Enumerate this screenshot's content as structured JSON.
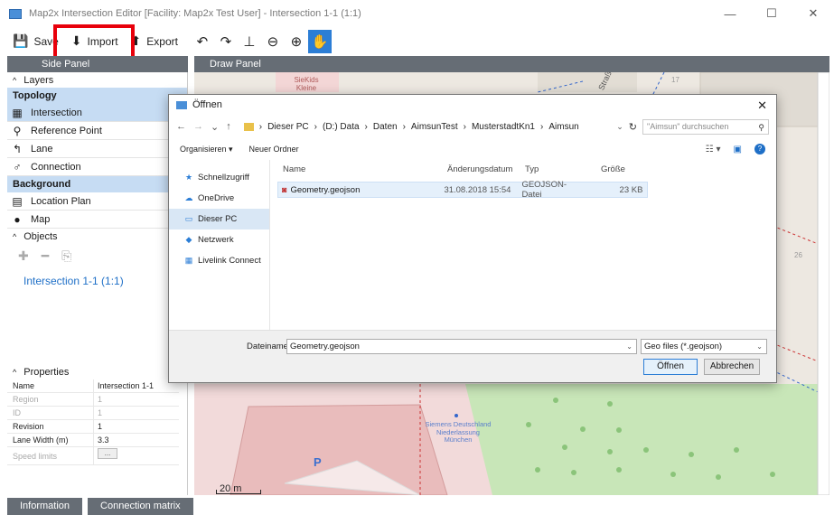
{
  "window": {
    "title": "Map2x Intersection Editor [Facility: Map2x Test User] - Intersection 1-1 (1:1)",
    "controls": [
      "—",
      "☐",
      "✕"
    ]
  },
  "toolbar": {
    "save_label": "Save",
    "import_label": "Import",
    "export_label": "Export"
  },
  "side_panel": {
    "header": "Side Panel",
    "layers_label": "Layers",
    "topology_label": "Topology",
    "topology_items": [
      "Intersection",
      "Reference Point",
      "Lane",
      "Connection"
    ],
    "background_label": "Background",
    "background_items": [
      "Location Plan",
      "Map"
    ],
    "objects_label": "Objects",
    "object_items": [
      "Intersection 1-1 (1:1)"
    ],
    "properties_label": "Properties",
    "properties": [
      {
        "key": "Name",
        "value": "Intersection 1-1"
      },
      {
        "key": "Region",
        "value": "1"
      },
      {
        "key": "ID",
        "value": "1"
      },
      {
        "key": "Revision",
        "value": "1"
      },
      {
        "key": "Lane Width (m)",
        "value": "3.3"
      },
      {
        "key": "Speed limits",
        "value": "..."
      }
    ]
  },
  "bottom_tabs": [
    "Information",
    "Connection matrix"
  ],
  "draw_panel": {
    "header": "Draw Panel",
    "map_labels": {
      "siekids": "SieKids Kleine",
      "siemens": "Siemens Deutschland Niederlassung München",
      "parking": "P",
      "scale": "20 m",
      "street_26": "26",
      "street_17": "17",
      "street_stra": "Straße"
    }
  },
  "dialog": {
    "title": "Öffnen",
    "path": [
      "Dieser PC",
      "(D:) Data",
      "Daten",
      "AimsunTest",
      "MusterstadtKn1",
      "Aimsun"
    ],
    "search_placeholder": "\"Aimsun\" durchsuchen",
    "organize_label": "Organisieren ▾",
    "new_folder_label": "Neuer Ordner",
    "nav_items": [
      "Schnellzugriff",
      "OneDrive",
      "Dieser PC",
      "Netzwerk",
      "Livelink Connect"
    ],
    "columns": [
      "Name",
      "Änderungsdatum",
      "Typ",
      "Größe"
    ],
    "files": [
      {
        "name": "Geometry.geojson",
        "date": "31.08.2018 15:54",
        "type": "GEOJSON-Datei",
        "size": "23 KB"
      }
    ],
    "filename_label": "Dateiname:",
    "filename_value": "Geometry.geojson",
    "filter_value": "Geo files (*.geojson)",
    "open_label": "Öffnen",
    "cancel_label": "Abbrechen"
  },
  "colors": {
    "accent": "#2c7ed6",
    "panel_header": "#666d75",
    "selection": "#c6dcf3",
    "highlight": "#e8000b"
  }
}
